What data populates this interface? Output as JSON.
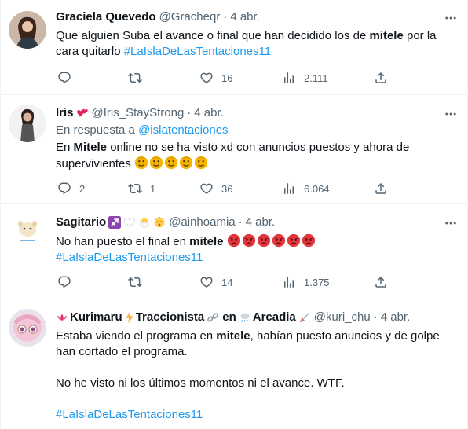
{
  "tweets": [
    {
      "name": "Graciela Quevedo",
      "handle": "@Gracheqr",
      "time": "4 abr.",
      "text_a": "Que alguien Suba el avance o final que han decidido los de ",
      "text_b": "mitele",
      "text_c": " por la cara quitarlo ",
      "hashtag": "#LaIslaDeLasTentaciones11",
      "replies": "",
      "retweets": "",
      "likes": "16",
      "views": "2.111"
    },
    {
      "name": "Iris",
      "handle": "@Iris_StayStrong",
      "time": "4 abr.",
      "reply_to_label": "En respuesta a ",
      "reply_to_handle": "@islatentaciones",
      "text_a": "En ",
      "text_b": "Mitele",
      "text_c": " online no se ha visto xd con anuncios puestos y ahora de supervivientes ",
      "replies": "2",
      "retweets": "1",
      "likes": "36",
      "views": "6.064"
    },
    {
      "name": "Sagitario",
      "handle": "@ainhoamia",
      "time": "4 abr.",
      "text_a": "No han puesto el final en ",
      "text_b": "mitele",
      "hashtag": "#LaIslaDeLasTentaciones11",
      "replies": "",
      "retweets": "",
      "likes": "14",
      "views": "1.375"
    },
    {
      "name_a": "Kurimaru",
      "name_b": "Traccionista",
      "name_c": "en",
      "name_d": "Arcadia",
      "handle": "@kuri_chu",
      "time": "4 abr.",
      "text_a": "Estaba viendo el programa en ",
      "text_b": "mitele",
      "text_c": ", habían puesto anuncios y de golpe han cortado el programa.",
      "text_d": "No he visto ni los últimos momentos ni el avance. WTF.",
      "hashtag": "#LaIslaDeLasTentaciones11"
    }
  ],
  "separator_dot": "·",
  "colors": {
    "link": "#1d9bf0",
    "muted": "#536471",
    "text": "#0f1419",
    "border": "#eff3f4"
  },
  "icons": [
    "reply-icon",
    "retweet-icon",
    "like-icon",
    "views-icon",
    "share-icon",
    "more-icon"
  ]
}
